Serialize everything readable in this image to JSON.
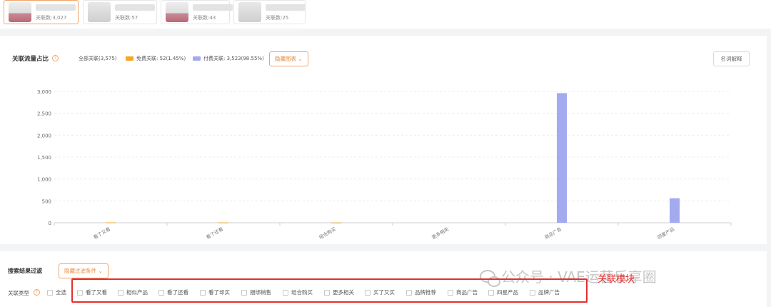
{
  "products": [
    {
      "count_label": "关联数:3,027",
      "active": true
    },
    {
      "count_label": "关联数:57",
      "active": false
    },
    {
      "count_label": "关联数:43",
      "active": false
    },
    {
      "count_label": "关联数:25",
      "active": false
    }
  ],
  "chart_panel": {
    "title": "关联流量占比",
    "legend_total": "全部关联(3,575)",
    "legend": [
      {
        "label": "免费关联: 52(1.45%)",
        "color": "#f5a623"
      },
      {
        "label": "付费关联: 3,523(98.55%)",
        "color": "#a3aaf0"
      }
    ],
    "hide_chart_button": "隐藏图表",
    "glossary_button": "名词解释"
  },
  "chart_data": {
    "type": "bar",
    "categories": [
      "看了又看",
      "看了还看",
      "组合购买",
      "更多相关",
      "商品广告",
      "四星产品"
    ],
    "series": [
      {
        "name": "免费关联",
        "color": "#f5a623",
        "values": [
          8,
          7,
          5,
          0,
          0,
          0
        ]
      },
      {
        "name": "付费关联",
        "color": "#a3aaf0",
        "values": [
          0,
          0,
          0,
          0,
          2960,
          560
        ]
      }
    ],
    "ylim": [
      0,
      3000
    ],
    "yticks": [
      0,
      500,
      1000,
      1500,
      2000,
      2500,
      3000
    ],
    "ytick_labels": [
      "0",
      "500",
      "1,000",
      "1,500",
      "2,000",
      "2,500",
      "3,000"
    ],
    "grid": true
  },
  "filter_panel": {
    "title": "搜索结果过滤",
    "hide_filter_button": "隐藏过滤条件",
    "type_label": "关联类型",
    "select_all": "全选",
    "options": [
      "看了又看",
      "相似产品",
      "看了还看",
      "看了却买",
      "捆绑销售",
      "组合购买",
      "更多相关",
      "买了又买",
      "品牌推荐",
      "商品广告",
      "四星产品",
      "品牌广告"
    ]
  },
  "annotation": {
    "text": "关联模块",
    "color": "#e62d2d"
  },
  "watermark": {
    "text": "公众号 · VAE运营乐享圈"
  }
}
